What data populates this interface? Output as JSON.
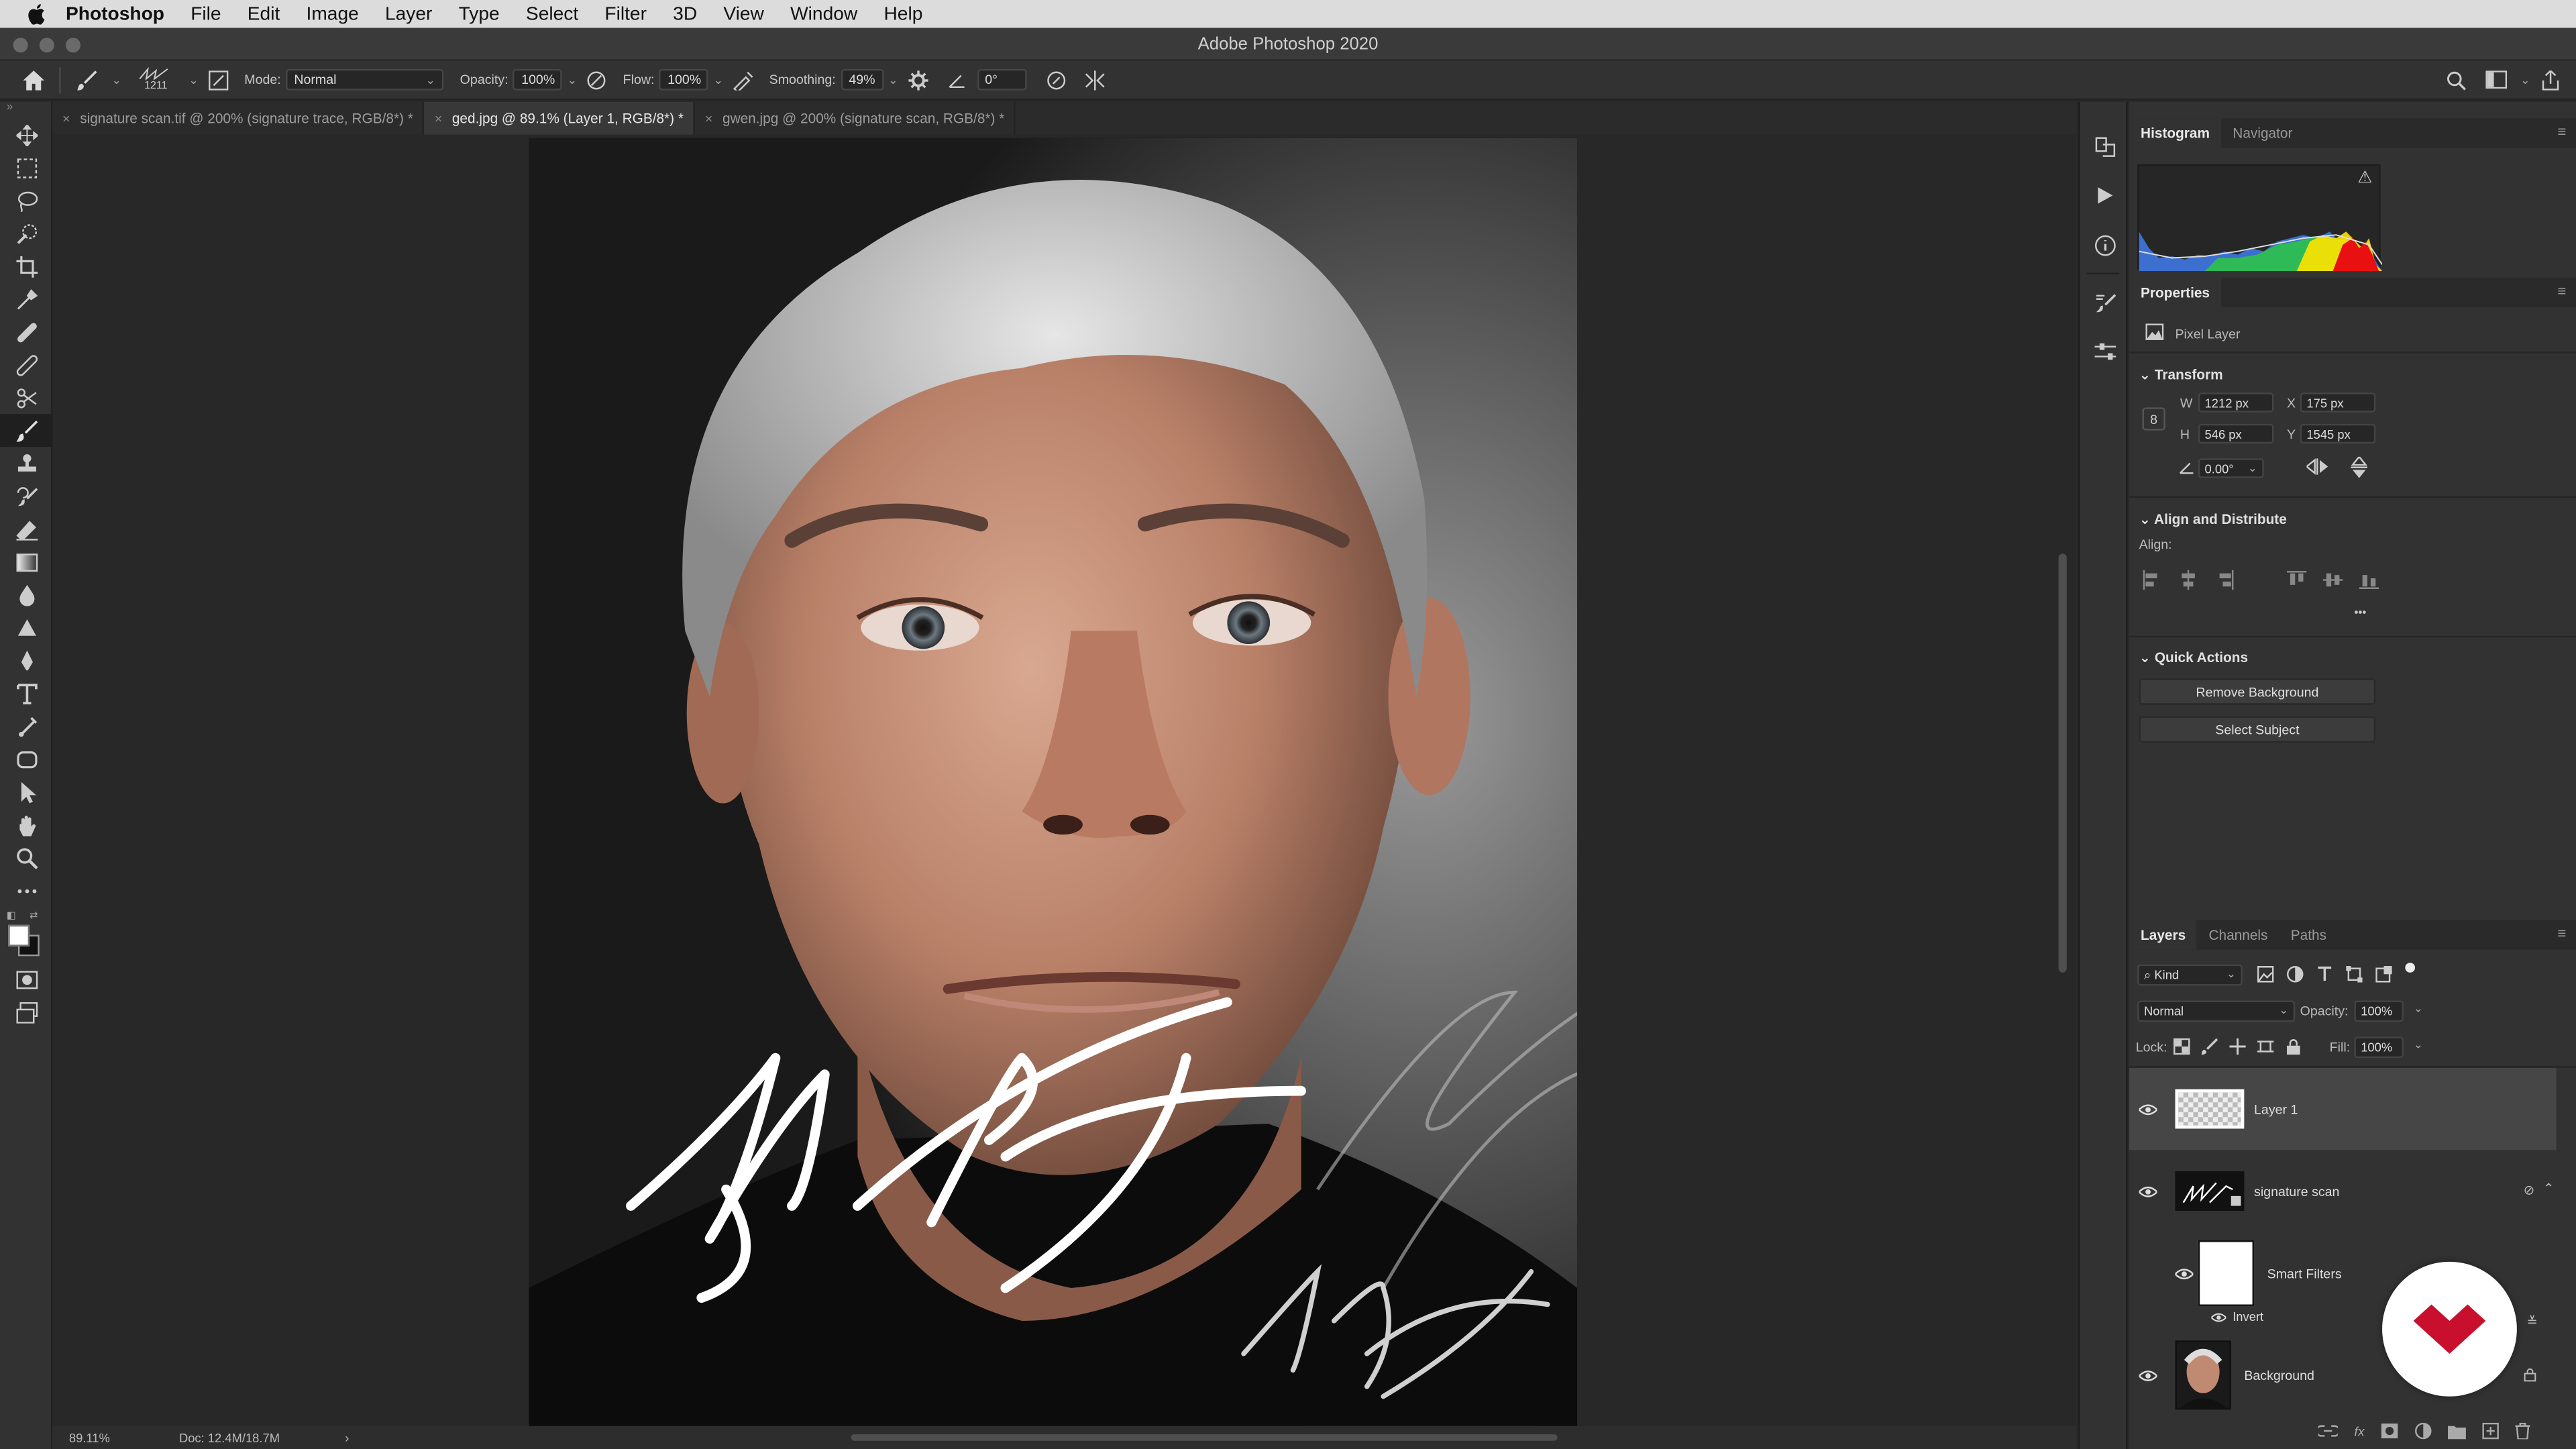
{
  "menubar": {
    "app": "Photoshop",
    "items": [
      "File",
      "Edit",
      "Image",
      "Layer",
      "Type",
      "Select",
      "Filter",
      "3D",
      "View",
      "Window",
      "Help"
    ]
  },
  "window": {
    "title": "Adobe Photoshop 2020"
  },
  "options": {
    "brush_size": "1211",
    "mode_label": "Mode:",
    "mode_value": "Normal",
    "opacity_label": "Opacity:",
    "opacity_value": "100%",
    "flow_label": "Flow:",
    "flow_value": "100%",
    "smoothing_label": "Smoothing:",
    "smoothing_value": "49%",
    "angle_value": "0°"
  },
  "tabs": [
    {
      "label": "signature scan.tif @ 200% (signature trace, RGB/8*) *",
      "active": false
    },
    {
      "label": "ged.jpg @ 89.1% (Layer 1, RGB/8*) *",
      "active": true
    },
    {
      "label": "gwen.jpg @ 200% (signature scan, RGB/8*) *",
      "active": false
    }
  ],
  "status": {
    "zoom": "89.11%",
    "doc": "Doc: 12.4M/18.7M",
    "arrow": "›"
  },
  "histogram": {
    "tabs": [
      "Histogram",
      "Navigator"
    ],
    "warning": "⚠"
  },
  "properties": {
    "title": "Properties",
    "layer_type": "Pixel Layer",
    "transform_title": "Transform",
    "w_label": "W",
    "w_value": "1212 px",
    "h_label": "H",
    "h_value": "546 px",
    "x_label": "X",
    "x_value": "175 px",
    "y_label": "Y",
    "y_value": "1545 px",
    "angle_value": "0.00°",
    "align_title": "Align and Distribute",
    "align_label": "Align:",
    "more": "•••",
    "quick_title": "Quick Actions",
    "remove_bg": "Remove Background",
    "select_subject": "Select Subject"
  },
  "layers_panel": {
    "tabs": [
      "Layers",
      "Channels",
      "Paths"
    ],
    "filter_kind": "Kind",
    "blend_mode": "Normal",
    "opacity_label": "Opacity:",
    "opacity_value": "100%",
    "lock_label": "Lock:",
    "fill_label": "Fill:",
    "fill_value": "100%",
    "layers": [
      {
        "name": "Layer 1"
      },
      {
        "name": "signature scan"
      },
      {
        "name": "Smart Filters"
      },
      {
        "name": "Invert"
      },
      {
        "name": "Background"
      }
    ]
  },
  "colors": {
    "accent": "#c8102e",
    "panel": "#323232",
    "canvas": "#282828"
  }
}
